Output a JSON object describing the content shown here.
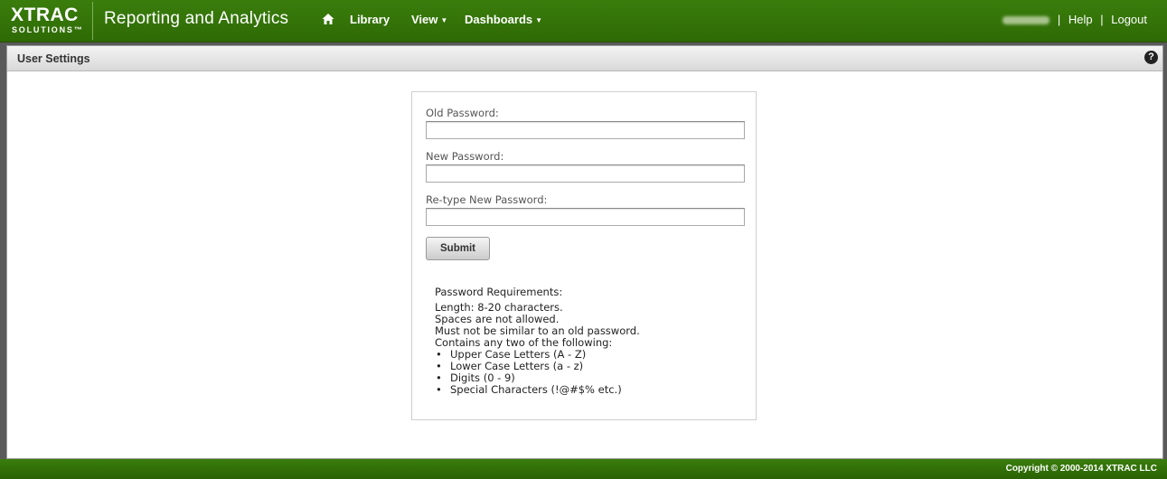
{
  "header": {
    "logo_main": "XTRAC",
    "logo_sub": "SOLUTIONS™",
    "app_title": "Reporting and Analytics",
    "nav": {
      "library": "Library",
      "view": "View",
      "dashboards": "Dashboards"
    },
    "user": {
      "username": "DESCAN",
      "help": "Help",
      "logout": "Logout"
    }
  },
  "panel": {
    "title": "User Settings",
    "help_icon": "?"
  },
  "form": {
    "old_password_label": "Old Password:",
    "new_password_label": "New Password:",
    "retype_password_label": "Re-type New Password:",
    "submit_label": "Submit",
    "requirements": {
      "title": "Password Requirements:",
      "lines": [
        "Length: 8-20 characters.",
        "Spaces are not allowed.",
        "Must not be similar to an old password.",
        "Contains any two of the following:"
      ],
      "bullets": [
        "Upper Case Letters (A - Z)",
        "Lower Case Letters (a - z)",
        "Digits (0 - 9)",
        "Special Characters (!@#$% etc.)"
      ]
    }
  },
  "footer": {
    "copyright": "Copyright © 2000-2014 XTRAC LLC"
  },
  "colors": {
    "brand_green": "#3a7d0c",
    "panel_header": "#d9d9d9"
  }
}
